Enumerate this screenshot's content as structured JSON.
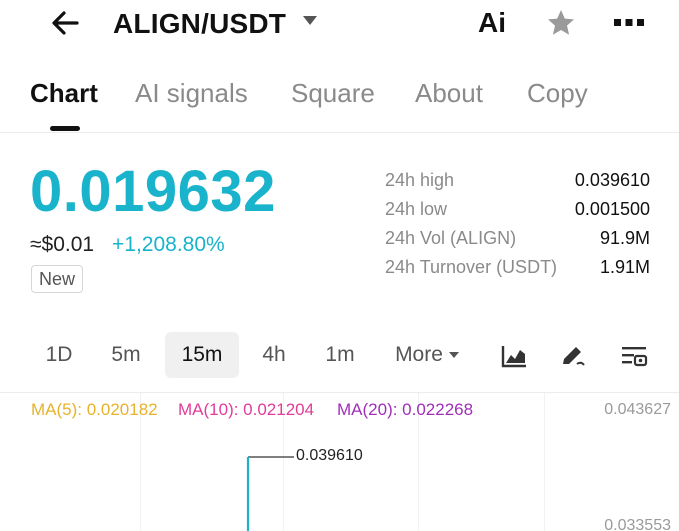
{
  "header": {
    "pair": "ALIGN/USDT",
    "ai_label": "Ai"
  },
  "tabs": [
    {
      "label": "Chart",
      "active": true
    },
    {
      "label": "AI signals"
    },
    {
      "label": "Square"
    },
    {
      "label": "About"
    },
    {
      "label": "Copy"
    }
  ],
  "price": {
    "last": "0.019632",
    "usd": "≈$0.01",
    "change": "+1,208.80%",
    "badge": "New"
  },
  "stats": [
    {
      "label": "24h high",
      "value": "0.039610"
    },
    {
      "label": "24h low",
      "value": "0.001500"
    },
    {
      "label": "24h Vol (ALIGN)",
      "value": "91.9M"
    },
    {
      "label": "24h Turnover (USDT)",
      "value": "1.91M"
    }
  ],
  "intervals": [
    {
      "label": "1D"
    },
    {
      "label": "5m"
    },
    {
      "label": "15m",
      "active": true
    },
    {
      "label": "4h"
    },
    {
      "label": "1m"
    },
    {
      "label": "More"
    }
  ],
  "chart": {
    "ma5": "MA(5): 0.020182",
    "ma10": "MA(10): 0.021204",
    "ma20": "MA(20): 0.022268",
    "axis_top": "0.043627",
    "axis_second": "0.033553",
    "high_label": "0.039610"
  },
  "colors": {
    "accent": "#1ab3cc",
    "ma5": "#e8b32a",
    "ma10": "#e23c9b",
    "ma20": "#a02fb8"
  }
}
